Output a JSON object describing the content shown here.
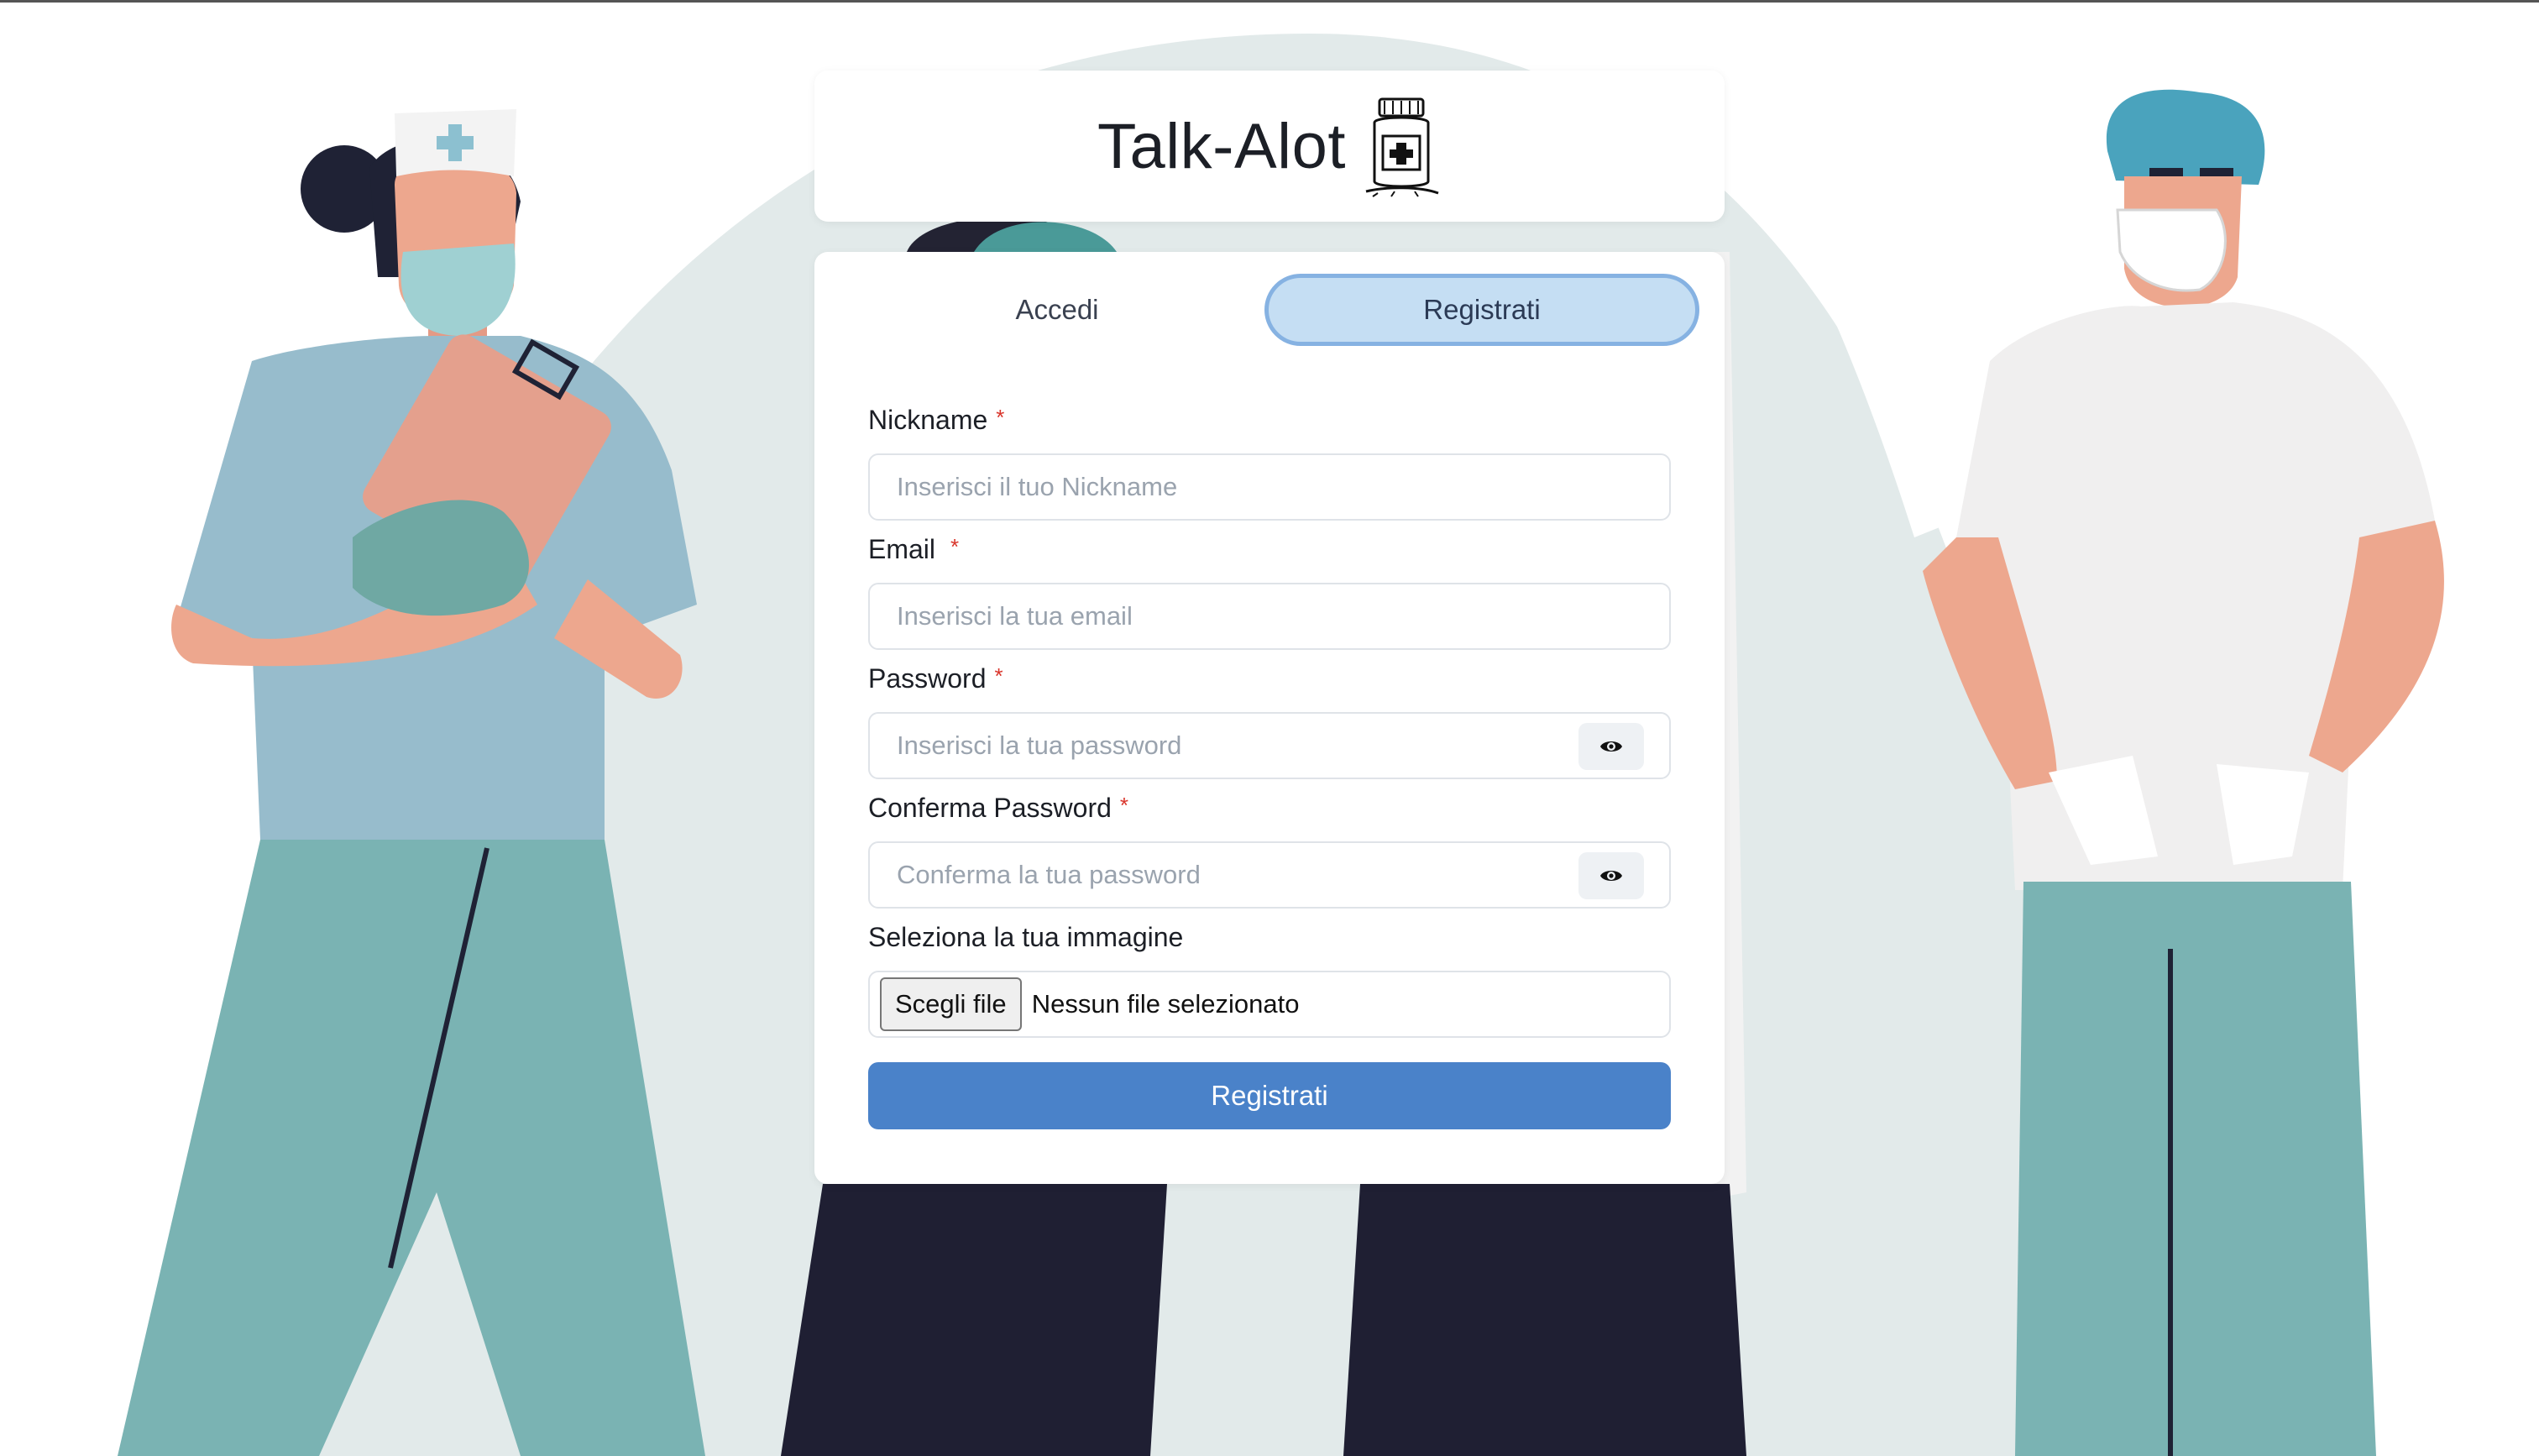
{
  "brand": {
    "name": "Talk-Alot",
    "logo_icon": "medicine-jar-icon"
  },
  "tabs": [
    {
      "label": "Accedi",
      "active": false
    },
    {
      "label": "Registrati",
      "active": true
    }
  ],
  "form": {
    "nickname": {
      "label": "Nickname",
      "required_mark": "*",
      "placeholder": "Inserisci il tuo Nickname",
      "value": ""
    },
    "email": {
      "label": "Email",
      "required_mark": "*",
      "placeholder": "Inserisci la tua email",
      "value": ""
    },
    "password": {
      "label": "Password",
      "required_mark": "*",
      "placeholder": "Inserisci la tua password",
      "value": "",
      "toggle_icon": "eye-icon"
    },
    "confirm_password": {
      "label": "Conferma Password",
      "required_mark": "*",
      "placeholder": "Conferma la tua password",
      "value": "",
      "toggle_icon": "eye-icon"
    },
    "image": {
      "label": "Seleziona la tua immagine",
      "button_label": "Scegli file",
      "status": "Nessun file selezionato"
    },
    "submit_label": "Registrati"
  },
  "colors": {
    "accent": "#4a82c9",
    "active_tab_bg": "#c5def3",
    "active_tab_border": "#86b2e2",
    "required": "#d9352b",
    "scrubs_teal": "#7ab3b3",
    "scrubs_blue": "#97bccc",
    "skin": "#eda78e"
  }
}
